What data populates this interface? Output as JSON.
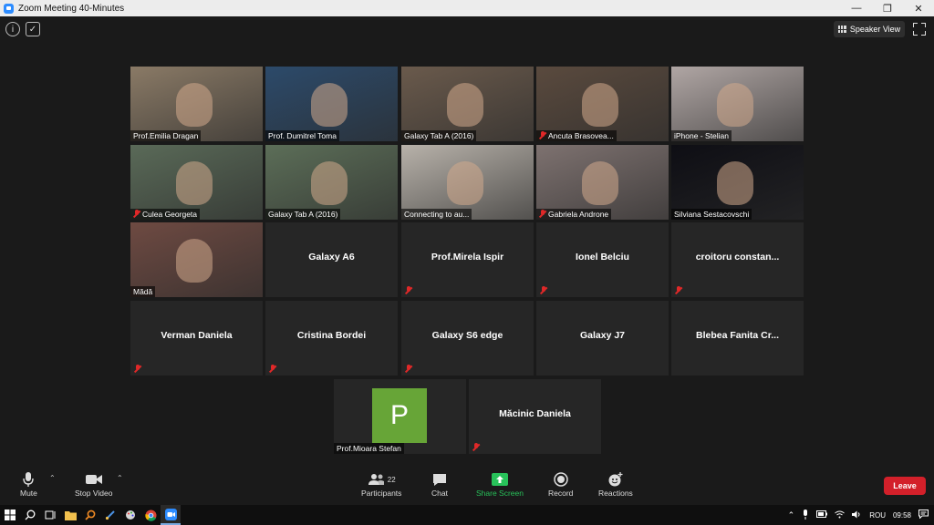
{
  "window": {
    "title": "Zoom Meeting 40-Minutes"
  },
  "header": {
    "speaker_view_label": "Speaker View"
  },
  "tiles": [
    {
      "name": "Prof.Emilia Dragan",
      "type": "video",
      "muted": false,
      "bg": "#8a7a66"
    },
    {
      "name": "Prof. Dumitrel Toma",
      "type": "video",
      "muted": false,
      "bg": "#2c4a6a"
    },
    {
      "name": "Galaxy Tab A (2016)",
      "type": "video",
      "muted": false,
      "bg": "#6a5a4c"
    },
    {
      "name": "Ancuta Brasovea...",
      "type": "video",
      "muted": true,
      "bg": "#5a4a3e"
    },
    {
      "name": "iPhone - Stelian",
      "type": "video",
      "muted": false,
      "bg": "#b0a6a4",
      "active": true
    },
    {
      "name": "Culea Georgeta",
      "type": "video",
      "muted": true,
      "bg": "#5a6a58"
    },
    {
      "name": "Galaxy Tab A (2016)",
      "type": "video",
      "muted": false,
      "bg": "#5c6e58"
    },
    {
      "name": "Connecting to au...",
      "type": "video",
      "muted": false,
      "bg": "#b8b2aa"
    },
    {
      "name": "Gabriela Androne",
      "type": "video",
      "muted": true,
      "bg": "#7e7270"
    },
    {
      "name": "Silviana Sestacovschi",
      "type": "video",
      "muted": false,
      "bg": "#0e0e14",
      "speaking": true
    },
    {
      "name": "Mădă",
      "type": "video",
      "muted": false,
      "bg": "#6e4a42"
    },
    {
      "name": "Galaxy A6",
      "type": "name",
      "muted": false
    },
    {
      "name": "Prof.Mirela Ispir",
      "type": "name",
      "muted": true
    },
    {
      "name": "Ionel Belciu",
      "type": "name",
      "muted": true
    },
    {
      "name": "croitoru  constan...",
      "type": "name",
      "muted": true
    },
    {
      "name": "Verman Daniela",
      "type": "name",
      "muted": true
    },
    {
      "name": "Cristina Bordei",
      "type": "name",
      "muted": true
    },
    {
      "name": "Galaxy S6 edge",
      "type": "name",
      "muted": true
    },
    {
      "name": "Galaxy J7",
      "type": "name",
      "muted": false
    },
    {
      "name": "Blebea  Fanita  Cr...",
      "type": "name",
      "muted": false
    },
    {
      "name": "Prof.Mioara Stefan",
      "type": "avatar",
      "initial": "P",
      "muted": false
    },
    {
      "name": "Măcinic Daniela",
      "type": "name",
      "muted": true
    }
  ],
  "toolbar": {
    "mute_label": "Mute",
    "stop_video_label": "Stop Video",
    "participants_label": "Participants",
    "participants_count": "22",
    "chat_label": "Chat",
    "share_screen_label": "Share Screen",
    "record_label": "Record",
    "reactions_label": "Reactions",
    "leave_label": "Leave"
  },
  "taskbar": {
    "language": "ROU",
    "time": "09:58"
  },
  "colors": {
    "accent_green": "#28c25a",
    "leave_red": "#d3202a",
    "active_border": "#c9e06b",
    "zoom_blue": "#2d8cff"
  }
}
